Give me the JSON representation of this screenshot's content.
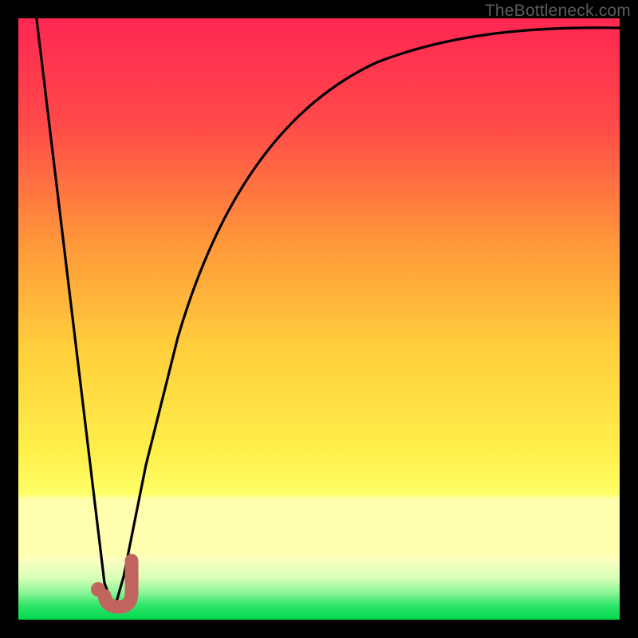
{
  "watermark": "TheBottleneck.com",
  "colors": {
    "frame": "#000000",
    "gradient_top": "#ff2753",
    "gradient_mid_upper": "#ff7a3c",
    "gradient_mid": "#ffd23a",
    "gradient_mid_lower": "#ffff66",
    "gradient_band": "#ffffb0",
    "gradient_bottom": "#00e756",
    "curve": "#000000",
    "marker_stroke": "#c2645e",
    "marker_fill": "#c2645e"
  },
  "chart_data": {
    "type": "line",
    "title": "",
    "xlabel": "",
    "ylabel": "",
    "xlim": [
      0,
      100
    ],
    "ylim": [
      0,
      100
    ],
    "note": "No axes or tick labels are visible; x is normalized position across plot width, y is bottleneck percentage (0 at bottom/green = no bottleneck, 100 at top/red = full bottleneck). Values read from curve geometry.",
    "series": [
      {
        "name": "bottleneck-curve",
        "x": [
          0,
          2.5,
          5,
          7.5,
          10,
          12.5,
          14,
          15,
          16,
          17.5,
          20,
          22.5,
          25,
          27.5,
          30,
          35,
          40,
          45,
          50,
          55,
          60,
          65,
          70,
          75,
          80,
          85,
          90,
          95,
          100
        ],
        "values": [
          108,
          92,
          76,
          60,
          44,
          28,
          16,
          5,
          2,
          4,
          16,
          30,
          42,
          52,
          60,
          71,
          78,
          83,
          86.5,
          89,
          91,
          92.5,
          93.8,
          94.8,
          95.6,
          96.2,
          96.7,
          97.1,
          97.5
        ]
      }
    ],
    "marker": {
      "name": "optimal-point",
      "shape": "J-hook",
      "x_range": [
        13.5,
        18.5
      ],
      "y_range": [
        0.5,
        7
      ],
      "dot": {
        "x": 13.8,
        "y": 3.2
      }
    },
    "gradient_bands_y": {
      "red_to_orange": [
        100,
        55
      ],
      "orange_to_yellow": [
        55,
        25
      ],
      "pale_yellow_band": [
        25,
        12
      ],
      "green_bottom": [
        5,
        0
      ]
    }
  }
}
